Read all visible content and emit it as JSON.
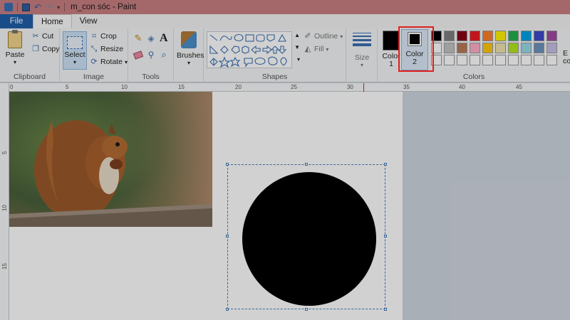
{
  "window": {
    "title": "m_con sóc - Paint"
  },
  "quick_access": {
    "icons": [
      "paint-app-icon",
      "save-icon",
      "undo-icon",
      "redo-icon",
      "customize-arrow-icon"
    ]
  },
  "tabs": [
    {
      "label": "File"
    },
    {
      "label": "Home"
    },
    {
      "label": "View"
    }
  ],
  "ribbon": {
    "clipboard": {
      "group_label": "Clipboard",
      "paste": "Paste",
      "cut": "Cut",
      "copy": "Copy"
    },
    "image": {
      "group_label": "Image",
      "select": "Select",
      "crop": "Crop",
      "resize": "Resize",
      "rotate": "Rotate"
    },
    "tools": {
      "group_label": "Tools"
    },
    "brushes": {
      "label": "Brushes"
    },
    "shapes": {
      "group_label": "Shapes",
      "outline": "Outline",
      "fill": "Fill"
    },
    "size": {
      "label": "Size"
    },
    "colors": {
      "group_label": "Colors",
      "color1_line1": "Color",
      "color1_line2": "1",
      "color2_line1": "Color",
      "color2_line2": "2",
      "edit_partial": "E",
      "edit_partial2": "co",
      "color1": "#000000",
      "color2": "#000000",
      "palette": [
        "#000000",
        "#7f7f7f",
        "#880015",
        "#ed1c24",
        "#ff7f27",
        "#fff200",
        "#22b14c",
        "#00a2e8",
        "#3f48cc",
        "#a349a4",
        "#ffffff",
        "#c3c3c3",
        "#b97a57",
        "#ffaec9",
        "#ffc90e",
        "#efe4b0",
        "#b5e61d",
        "#99d9ea",
        "#7092be",
        "#c8bfe7",
        "#ffffff",
        "#ffffff",
        "#ffffff",
        "#ffffff",
        "#ffffff",
        "#ffffff",
        "#ffffff",
        "#ffffff",
        "#ffffff",
        "#ffffff"
      ]
    }
  },
  "ruler": {
    "top_labels": [
      "0",
      "5",
      "10",
      "15",
      "20",
      "25",
      "30",
      "35",
      "40",
      "45"
    ],
    "left_labels": [
      "5",
      "10",
      "15"
    ]
  },
  "canvas": {
    "photo_subject": "red squirrel eating on a wooden log",
    "shape": "filled black circle (selected)"
  }
}
